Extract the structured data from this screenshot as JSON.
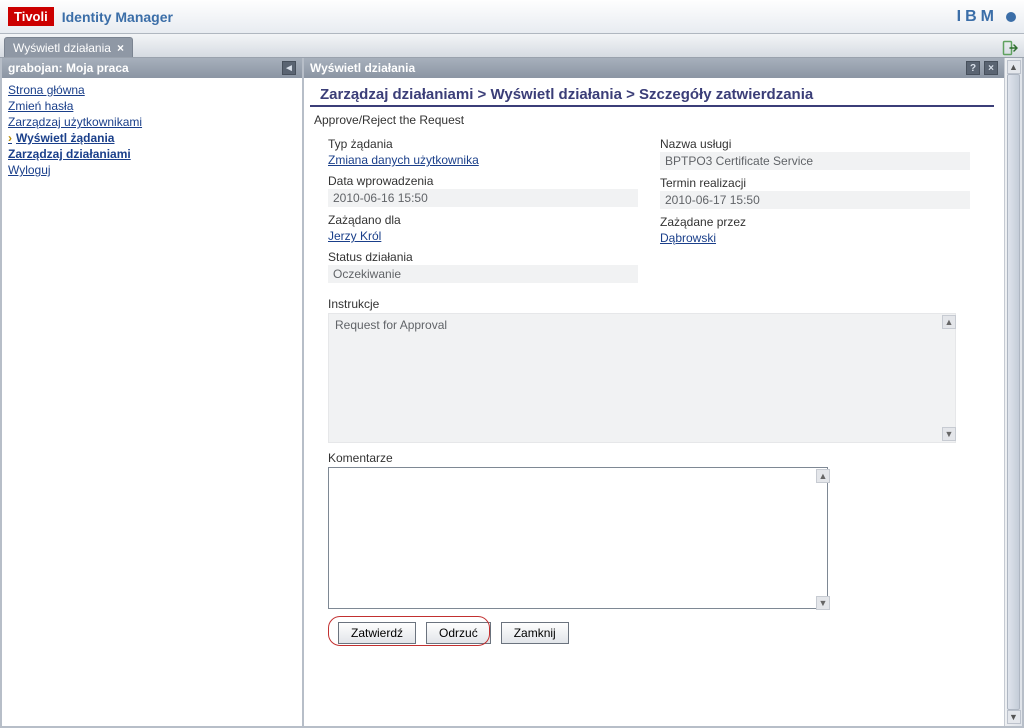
{
  "banner": {
    "brand": "Tivoli",
    "product": "Identity Manager",
    "ibm": "IBM"
  },
  "tab": {
    "label": "Wyświetl działania"
  },
  "sidebar": {
    "title": "grabojan: Moja praca",
    "items": {
      "home": {
        "label": "Strona główna"
      },
      "passwd": {
        "label": "Zmień hasła"
      },
      "users": {
        "label": "Zarządzaj użytkownikami"
      },
      "req": {
        "label": "Wyświetl żądania"
      },
      "act": {
        "label": "Zarządzaj działaniami"
      },
      "logout": {
        "label": "Wyloguj"
      }
    }
  },
  "content": {
    "title": "Wyświetl działania",
    "breadcrumb": "Zarządzaj działaniami > Wyświetl działania > Szczegóły zatwierdzania",
    "subtitle": "Approve/Reject the Request",
    "left": {
      "req_type": {
        "label": "Typ żądania",
        "value": "Zmiana danych użytkownika"
      },
      "entry_date": {
        "label": "Data wprowadzenia",
        "value": "2010-06-16 15:50"
      },
      "for": {
        "label": "Zażądano dla",
        "value": "Jerzy Król"
      },
      "status": {
        "label": "Status działania",
        "value": "Oczekiwanie"
      }
    },
    "right": {
      "service": {
        "label": "Nazwa usługi",
        "value": "BPTPO3 Certificate Service"
      },
      "due": {
        "label": "Termin realizacji",
        "value": "2010-06-17 15:50"
      },
      "by": {
        "label": "Zażądane przez",
        "value": "Dąbrowski"
      }
    },
    "instructions": {
      "label": "Instrukcje",
      "value": "Request for Approval"
    },
    "comments": {
      "label": "Komentarze",
      "value": ""
    },
    "buttons": {
      "approve": "Zatwierdź",
      "reject": "Odrzuć",
      "close": "Zamknij"
    }
  }
}
